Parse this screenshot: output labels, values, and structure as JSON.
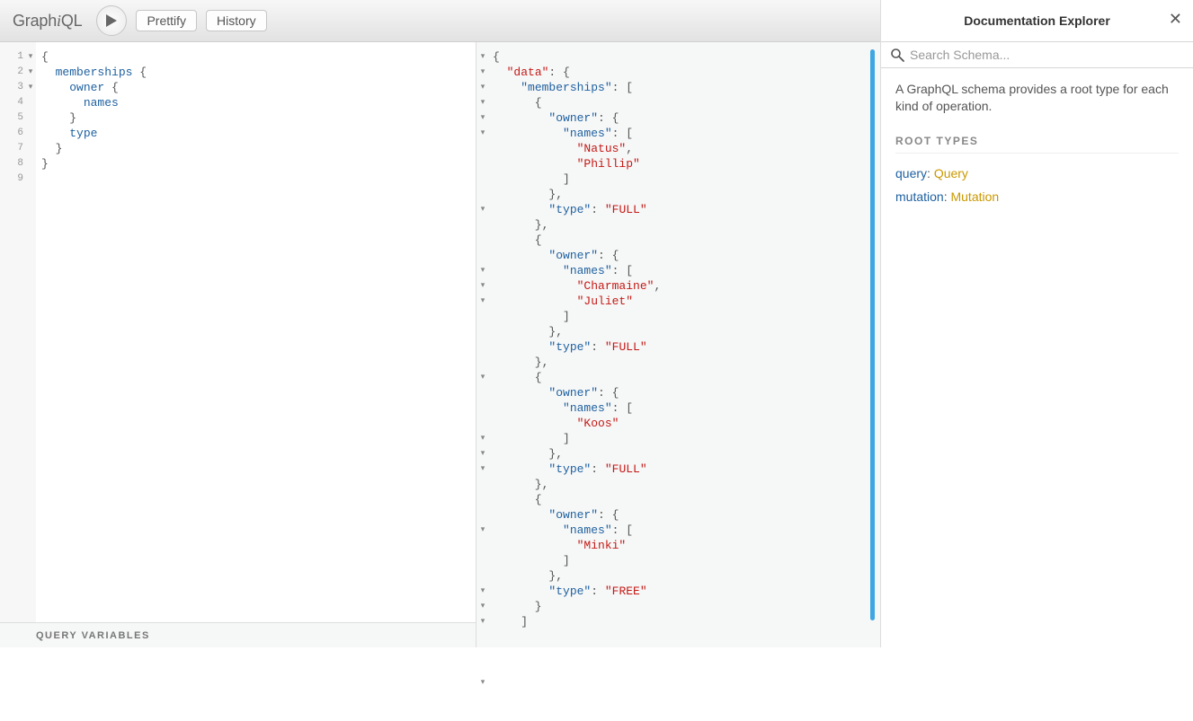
{
  "logo": {
    "part1": "Graph",
    "part2": "i",
    "part3": "QL"
  },
  "toolbar": {
    "prettify": "Prettify",
    "history": "History"
  },
  "query": {
    "line_numbers": [
      "1",
      "2",
      "3",
      "4",
      "5",
      "6",
      "7",
      "8",
      "9"
    ],
    "fold_markers": [
      "▾",
      "▾",
      "▾",
      "",
      "",
      "",
      "",
      "",
      ""
    ],
    "lines": [
      [
        {
          "t": "{",
          "c": "tok-punc"
        }
      ],
      [
        {
          "t": "  ",
          "c": ""
        },
        {
          "t": "memberships",
          "c": "tok-attr"
        },
        {
          "t": " {",
          "c": "tok-punc"
        }
      ],
      [
        {
          "t": "    ",
          "c": ""
        },
        {
          "t": "owner",
          "c": "tok-attr"
        },
        {
          "t": " {",
          "c": "tok-punc"
        }
      ],
      [
        {
          "t": "      ",
          "c": ""
        },
        {
          "t": "names",
          "c": "tok-attr"
        }
      ],
      [
        {
          "t": "    }",
          "c": "tok-punc"
        }
      ],
      [
        {
          "t": "    ",
          "c": ""
        },
        {
          "t": "type",
          "c": "tok-attr"
        }
      ],
      [
        {
          "t": "  }",
          "c": "tok-punc"
        }
      ],
      [
        {
          "t": "}",
          "c": "tok-punc"
        }
      ],
      [
        {
          "t": "",
          "c": ""
        }
      ]
    ]
  },
  "variables_label": "Query Variables",
  "result": {
    "fold_markers": [
      "▾",
      "▾",
      "▾",
      "▾",
      "▾",
      "▾",
      "",
      "",
      "",
      "",
      "▾",
      "",
      "",
      "",
      "▾",
      "▾",
      "▾",
      "",
      "",
      "",
      "",
      "▾",
      "",
      "",
      "",
      "▾",
      "▾",
      "▾",
      "",
      "",
      "",
      "▾",
      "",
      "",
      "",
      "▾",
      "▾",
      "▾",
      "",
      "",
      "",
      "▾",
      "",
      ""
    ],
    "lines": [
      [
        {
          "t": "{",
          "c": ""
        }
      ],
      [
        {
          "t": "  ",
          "c": ""
        },
        {
          "t": "\"data\"",
          "c": "d"
        },
        {
          "t": ": {",
          "c": ""
        }
      ],
      [
        {
          "t": "    ",
          "c": ""
        },
        {
          "t": "\"memberships\"",
          "c": "k"
        },
        {
          "t": ": [",
          "c": ""
        }
      ],
      [
        {
          "t": "      {",
          "c": ""
        }
      ],
      [
        {
          "t": "        ",
          "c": ""
        },
        {
          "t": "\"owner\"",
          "c": "k"
        },
        {
          "t": ": {",
          "c": ""
        }
      ],
      [
        {
          "t": "          ",
          "c": ""
        },
        {
          "t": "\"names\"",
          "c": "k"
        },
        {
          "t": ": [",
          "c": ""
        }
      ],
      [
        {
          "t": "            ",
          "c": ""
        },
        {
          "t": "\"Natus\"",
          "c": "s"
        },
        {
          "t": ",",
          "c": ""
        }
      ],
      [
        {
          "t": "            ",
          "c": ""
        },
        {
          "t": "\"Phillip\"",
          "c": "s"
        }
      ],
      [
        {
          "t": "          ]",
          "c": ""
        }
      ],
      [
        {
          "t": "        },",
          "c": ""
        }
      ],
      [
        {
          "t": "        ",
          "c": ""
        },
        {
          "t": "\"type\"",
          "c": "k"
        },
        {
          "t": ": ",
          "c": ""
        },
        {
          "t": "\"FULL\"",
          "c": "s"
        }
      ],
      [
        {
          "t": "      },",
          "c": ""
        }
      ],
      [
        {
          "t": "      {",
          "c": ""
        }
      ],
      [
        {
          "t": "        ",
          "c": ""
        },
        {
          "t": "\"owner\"",
          "c": "k"
        },
        {
          "t": ": {",
          "c": ""
        }
      ],
      [
        {
          "t": "          ",
          "c": ""
        },
        {
          "t": "\"names\"",
          "c": "k"
        },
        {
          "t": ": [",
          "c": ""
        }
      ],
      [
        {
          "t": "            ",
          "c": ""
        },
        {
          "t": "\"Charmaine\"",
          "c": "s"
        },
        {
          "t": ",",
          "c": ""
        }
      ],
      [
        {
          "t": "            ",
          "c": ""
        },
        {
          "t": "\"Juliet\"",
          "c": "s"
        }
      ],
      [
        {
          "t": "          ]",
          "c": ""
        }
      ],
      [
        {
          "t": "        },",
          "c": ""
        }
      ],
      [
        {
          "t": "        ",
          "c": ""
        },
        {
          "t": "\"type\"",
          "c": "k"
        },
        {
          "t": ": ",
          "c": ""
        },
        {
          "t": "\"FULL\"",
          "c": "s"
        }
      ],
      [
        {
          "t": "      },",
          "c": ""
        }
      ],
      [
        {
          "t": "      {",
          "c": ""
        }
      ],
      [
        {
          "t": "        ",
          "c": ""
        },
        {
          "t": "\"owner\"",
          "c": "k"
        },
        {
          "t": ": {",
          "c": ""
        }
      ],
      [
        {
          "t": "          ",
          "c": ""
        },
        {
          "t": "\"names\"",
          "c": "k"
        },
        {
          "t": ": [",
          "c": ""
        }
      ],
      [
        {
          "t": "            ",
          "c": ""
        },
        {
          "t": "\"Koos\"",
          "c": "s"
        }
      ],
      [
        {
          "t": "          ]",
          "c": ""
        }
      ],
      [
        {
          "t": "        },",
          "c": ""
        }
      ],
      [
        {
          "t": "        ",
          "c": ""
        },
        {
          "t": "\"type\"",
          "c": "k"
        },
        {
          "t": ": ",
          "c": ""
        },
        {
          "t": "\"FULL\"",
          "c": "s"
        }
      ],
      [
        {
          "t": "      },",
          "c": ""
        }
      ],
      [
        {
          "t": "      {",
          "c": ""
        }
      ],
      [
        {
          "t": "        ",
          "c": ""
        },
        {
          "t": "\"owner\"",
          "c": "k"
        },
        {
          "t": ": {",
          "c": ""
        }
      ],
      [
        {
          "t": "          ",
          "c": ""
        },
        {
          "t": "\"names\"",
          "c": "k"
        },
        {
          "t": ": [",
          "c": ""
        }
      ],
      [
        {
          "t": "            ",
          "c": ""
        },
        {
          "t": "\"Minki\"",
          "c": "s"
        }
      ],
      [
        {
          "t": "          ]",
          "c": ""
        }
      ],
      [
        {
          "t": "        },",
          "c": ""
        }
      ],
      [
        {
          "t": "        ",
          "c": ""
        },
        {
          "t": "\"type\"",
          "c": "k"
        },
        {
          "t": ": ",
          "c": ""
        },
        {
          "t": "\"FREE\"",
          "c": "s"
        }
      ],
      [
        {
          "t": "      }",
          "c": ""
        }
      ],
      [
        {
          "t": "    ]",
          "c": ""
        }
      ]
    ]
  },
  "docs": {
    "title": "Documentation Explorer",
    "search_placeholder": "Search Schema...",
    "description": "A GraphQL schema provides a root type for each kind of operation.",
    "section": "ROOT TYPES",
    "fields": [
      {
        "name": "query",
        "type": "Query"
      },
      {
        "name": "mutation",
        "type": "Mutation"
      }
    ]
  }
}
